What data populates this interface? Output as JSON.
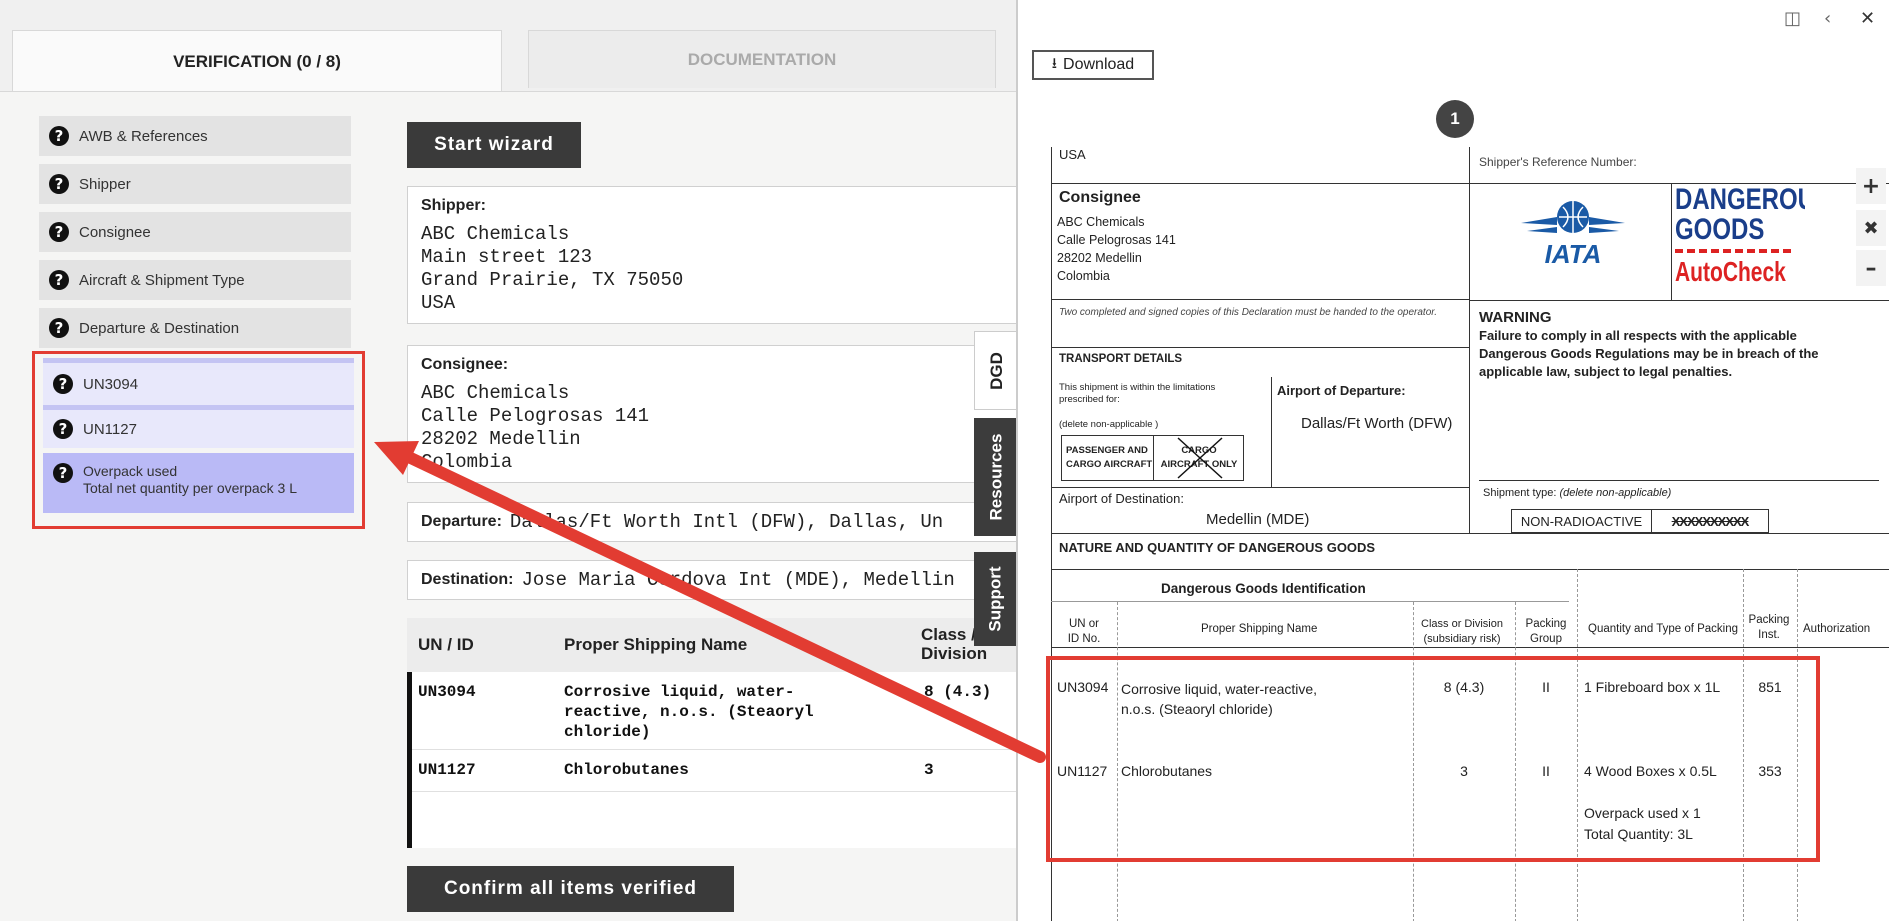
{
  "tabs": {
    "verification": "VERIFICATION (0 / 8)",
    "documentation": "DOCUMENTATION"
  },
  "nav": {
    "items": [
      "AWB & References",
      "Shipper",
      "Consignee",
      "Aircraft & Shipment Type",
      "Departure & Destination"
    ],
    "subitems": [
      "UN3094",
      "UN1127"
    ],
    "overpack": {
      "line1": "Overpack used",
      "line2": "Total net quantity per overpack 3 L"
    }
  },
  "buttons": {
    "start_wizard": "Start wizard",
    "confirm": "Confirm all items verified",
    "download": "Download"
  },
  "shipper": {
    "label": "Shipper:",
    "lines": [
      "ABC Chemicals",
      "Main street 123",
      "Grand Prairie, TX 75050",
      "USA"
    ]
  },
  "consignee": {
    "label": "Consignee:",
    "lines": [
      "ABC Chemicals",
      "Calle Pelogrosas 141",
      "28202 Medellin",
      "Colombia"
    ]
  },
  "departure": {
    "label": "Departure:",
    "value": "Dallas/Ft Worth Intl (DFW), Dallas, Un"
  },
  "destination": {
    "label": "Destination:",
    "value": "Jose Maria Cordova Int (MDE), Medellin"
  },
  "items_table": {
    "headers": {
      "un": "UN / ID",
      "psn": "Proper Shipping Name",
      "cls1": "Class /",
      "cls2": "Division"
    },
    "rows": [
      {
        "un": "UN3094",
        "psn1": "Corrosive liquid, water-",
        "psn2": "reactive, n.o.s. (Steaoryl",
        "psn3": "chloride)",
        "cls": "8 (4.3)"
      },
      {
        "un": "UN1127",
        "psn1": "Chlorobutanes",
        "cls": "3"
      }
    ]
  },
  "side_tabs": {
    "dgd": "DGD",
    "resources": "Resources",
    "support": "Support"
  },
  "panel": {
    "page_number": "1"
  },
  "doc": {
    "usa": "USA",
    "shipper_ref": "Shipper's Reference Number:",
    "consignee_title": "Consignee",
    "consignee_lines": [
      "ABC Chemicals",
      "Calle Pelogrosas 141",
      "28202 Medellin",
      "Colombia"
    ],
    "copies_note": "Two completed and signed copies of this Declaration must be handed to the operator.",
    "iata": "IATA",
    "dg_logo": {
      "line1": "DANGEROUS",
      "line2": "GOODS",
      "line3": "AutoCheck"
    },
    "warning_title": "WARNING",
    "warning_text": [
      "Failure to comply in all respects with the applicable",
      "Dangerous Goods Regulations may be in breach of the",
      "applicable law, subject to legal penalties."
    ],
    "transport_title": "TRANSPORT DETAILS",
    "limits_text": [
      "This shipment is within the limitations",
      "prescribed for:"
    ],
    "delete_note": "(delete non-applicable )",
    "passenger": [
      "PASSENGER AND",
      "CARGO AIRCRAFT"
    ],
    "cargo_only": [
      "CARGO",
      "AIRCRAFT ONLY"
    ],
    "airport_departure_label": "Airport of Departure:",
    "airport_departure": "Dallas/Ft Worth (DFW)",
    "airport_destination_label": "Airport of Destination:",
    "airport_destination": "Medellin (MDE)",
    "shipment_type_label": "Shipment type:",
    "shipment_type_note": "(delete non-applicable)",
    "non_radioactive": "NON-RADIOACTIVE",
    "radioactive_struck": "XXXXXXXXXX",
    "nature_title": "NATURE AND QUANTITY OF DANGEROUS GOODS",
    "dg_ident": "Dangerous Goods Identification",
    "cols": {
      "un1": "UN or",
      "un2": "ID No.",
      "psn": "Proper Shipping Name",
      "cls1": "Class or Division",
      "cls2": "(subsidiary risk)",
      "pg1": "Packing",
      "pg2": "Group",
      "qty": "Quantity and Type of Packing",
      "pi1": "Packing",
      "pi2": "Inst.",
      "auth": "Authorization"
    },
    "rows": [
      {
        "un": "UN3094",
        "psn1": "Corrosive liquid, water-reactive,",
        "psn2": "n.o.s. (Steaoryl chloride)",
        "cls": "8 (4.3)",
        "pg": "II",
        "qty": "1 Fibreboard box x 1L",
        "pi": "851"
      },
      {
        "un": "UN1127",
        "psn1": "Chlorobutanes",
        "cls": "3",
        "pg": "II",
        "qty": "4 Wood Boxes x 0.5L",
        "pi": "353",
        "overpack1": "Overpack used x 1",
        "overpack2": "Total Quantity: 3L"
      }
    ]
  },
  "colors": {
    "highlight": "#e23c32",
    "dark_button": "#3a3a3a",
    "active_nav": "#babaf6",
    "sub_nav": "#e8e8fb"
  }
}
